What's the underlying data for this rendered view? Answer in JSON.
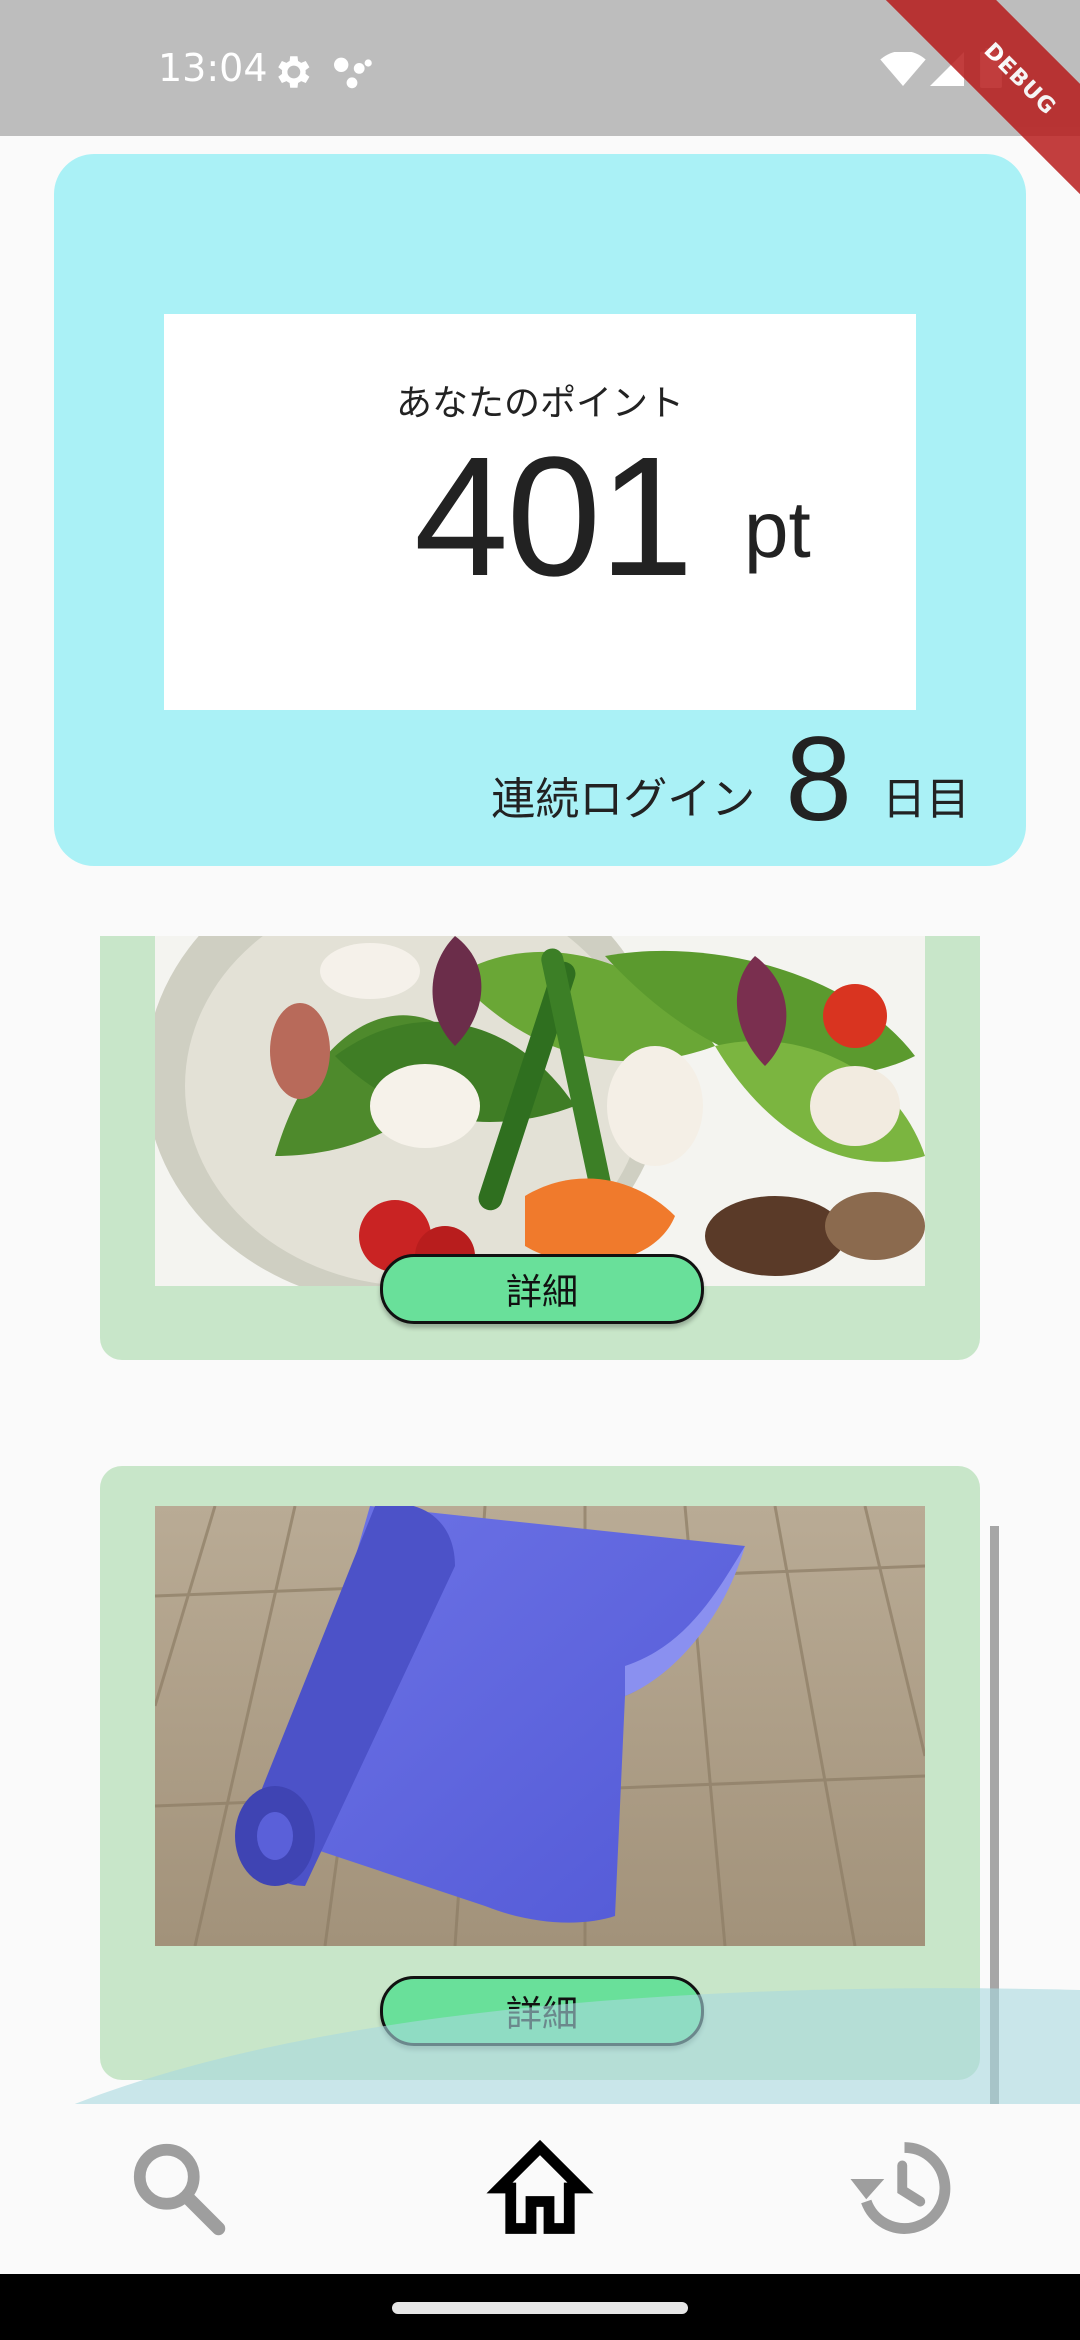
{
  "status": {
    "time": "13:04",
    "debug_label": "DEBUG"
  },
  "points": {
    "label": "あなたのポイント",
    "value": "401",
    "unit": "pt"
  },
  "login": {
    "prefix": "連続ログイン",
    "days": "8",
    "suffix": "日目"
  },
  "cards": [
    {
      "image": "salad-photo",
      "button_label": "詳細"
    },
    {
      "image": "yoga-mat-photo",
      "button_label": "詳細"
    }
  ],
  "nav": {
    "items": [
      "search-icon",
      "home-icon",
      "history-icon"
    ],
    "active": "home-icon"
  },
  "colors": {
    "panel": "#aaf1f6",
    "card": "#c8e6c9",
    "button": "#69e09a"
  }
}
